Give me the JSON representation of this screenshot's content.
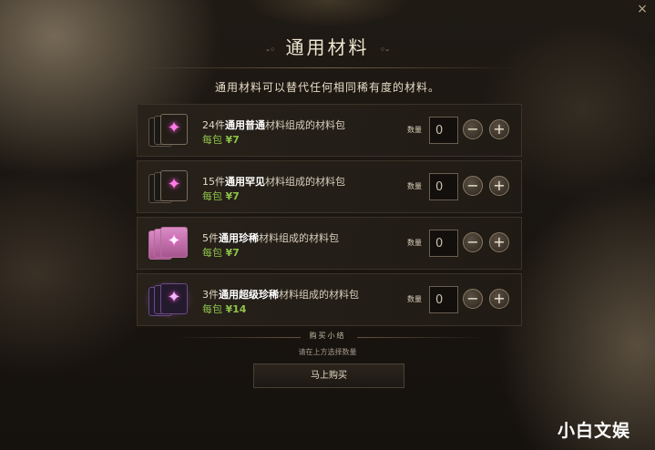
{
  "header": {
    "title": "通用材料",
    "ornament_left": "-◦",
    "ornament_right": "◦-",
    "subtitle": "通用材料可以替代任何相同稀有度的材料。",
    "close_icon": "×"
  },
  "rows": [
    {
      "qty_prefix": "24件",
      "bold": "通用普通",
      "suffix": "材料组成的材料包",
      "price_label": "每包",
      "price": "¥7",
      "quantity_label": "数量",
      "quantity_value": "0",
      "icon": "common-material-icon"
    },
    {
      "qty_prefix": "15件",
      "bold": "通用罕见",
      "suffix": "材料组成的材料包",
      "price_label": "每包",
      "price": "¥7",
      "quantity_label": "数量",
      "quantity_value": "0",
      "icon": "uncommon-material-icon"
    },
    {
      "qty_prefix": "5件",
      "bold": "通用珍稀",
      "suffix": "材料组成的材料包",
      "price_label": "每包",
      "price": "¥7",
      "quantity_label": "数量",
      "quantity_value": "0",
      "icon": "rare-material-icon"
    },
    {
      "qty_prefix": "3件",
      "bold": "通用超级珍稀",
      "suffix": "材料组成的材料包",
      "price_label": "每包",
      "price": "¥14",
      "quantity_label": "数量",
      "quantity_value": "0",
      "icon": "epic-material-icon"
    }
  ],
  "controls": {
    "minus": "−",
    "plus": "+",
    "star": "✦"
  },
  "summary": {
    "title": "购买小结",
    "hint": "请在上方选择数量",
    "buy_label": "马上购买"
  },
  "watermark": "小白文娱",
  "colors": {
    "accent_price": "#8fc24a",
    "rare_card": "#d98bc5",
    "star": "#ff7be8"
  }
}
